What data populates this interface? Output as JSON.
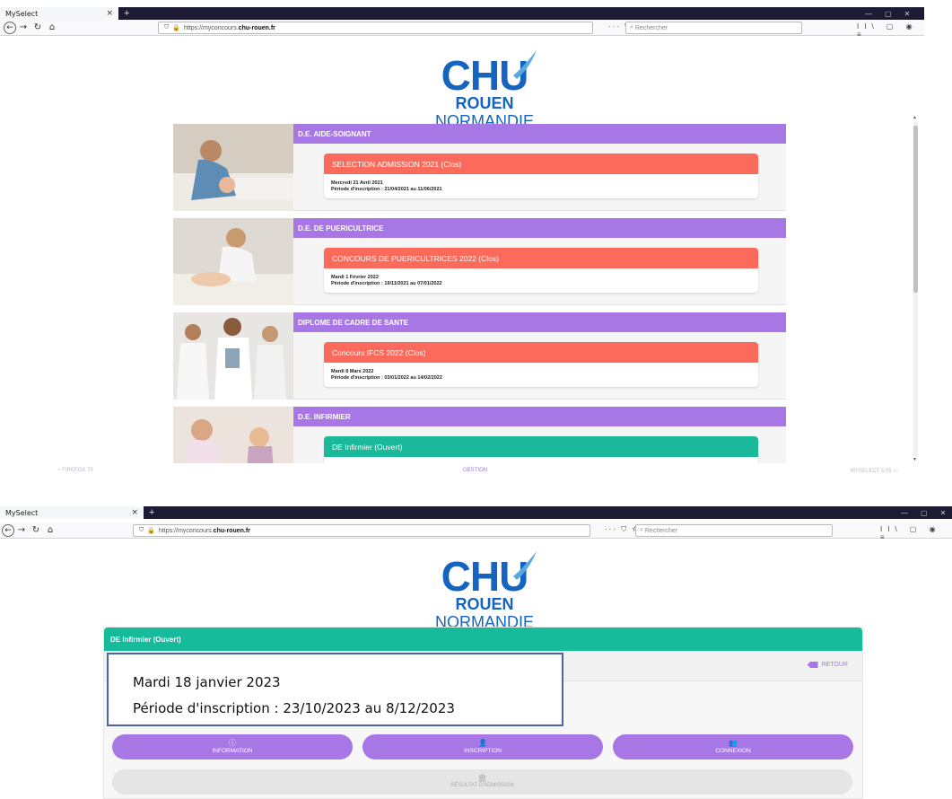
{
  "shot1": {
    "tab_title": "MySelect",
    "url_prefix": "https://myconcours.",
    "url_host": "chu-rouen.fr",
    "page_actions": "··· ⛉ ☆",
    "search_placeholder": "Rechercher",
    "tools": "II\\ ▢ ◉ ≡",
    "logo": {
      "chu": "CHU",
      "rouen": "ROUEN",
      "normandie": "NORMANDIE"
    },
    "entries": [
      {
        "category": "D.E. AIDE-SOIGNANT",
        "title": "SELECTION ADMISSION 2021 (Clos)",
        "date": "Mercredi 21 Avril 2021",
        "period": "Période d'inscription : 21/04/2021 au 11/06/2021",
        "status": "closed"
      },
      {
        "category": "D.E. DE PUERICULTRICE",
        "title": "CONCOURS DE PUERICULTRICES 2022 (Clos)",
        "date": "Mardi 1 Février 2022",
        "period": "Période d'inscription : 19/11/2021 au 07/01/2022",
        "status": "closed"
      },
      {
        "category": "DIPLOME DE CADRE DE SANTE",
        "title": "Concours IFCS 2022 (Clos)",
        "date": "Mardi 8 Mars 2022",
        "period": "Période d'inscription : 03/01/2022 au 14/02/2022",
        "status": "closed"
      },
      {
        "category": "D.E. INFIRMIER",
        "title": "DE Infirmier (Ouvert)",
        "date": "",
        "period": "",
        "status": "open"
      }
    ],
    "footer": {
      "left": "FIREFOX 79",
      "center": "GESTION",
      "right": "MYSELECT 5.05"
    }
  },
  "shot2": {
    "tab_title": "MySelect",
    "url_prefix": "https://myconcours.",
    "url_host": "chu-rouen.fr",
    "page_actions": "··· ⛉ ☆",
    "search_placeholder": "Rechercher",
    "tools": "II\\ ▢ ◉ ≡",
    "logo": {
      "chu": "CHU",
      "rouen": "ROUEN",
      "normandie": "NORMANDIE"
    },
    "panel_title": "DE Infirmier (Ouvert)",
    "retour_label": "RETOUR",
    "info_date": "Mardi 18 janvier 2023",
    "info_period": "Période d'inscription : 23/10/2023 au 8/12/2023",
    "buttons": {
      "information": "INFORMATION",
      "inscription": "INSCRIPTION",
      "connexion": "CONNEXION",
      "resultat": "RÉSULTAT D'ADMISSION"
    }
  },
  "colors": {
    "purple": "#a877e6",
    "coral": "#fb6a5b",
    "teal": "#19b99a",
    "chu_blue": "#1565c0",
    "annotation_border": "#4a64a8"
  },
  "icons": [
    "back-arrow-icon",
    "forward-arrow-icon",
    "reload-icon",
    "home-icon",
    "shield-icon",
    "lock-icon",
    "bookmark-star-icon",
    "library-icon",
    "sidebar-icon",
    "account-icon",
    "menu-icon",
    "info-icon",
    "add-user-icon",
    "users-icon",
    "bank-icon",
    "back-arrow-retour-icon",
    "monitor-icon",
    "firefox-icon"
  ]
}
